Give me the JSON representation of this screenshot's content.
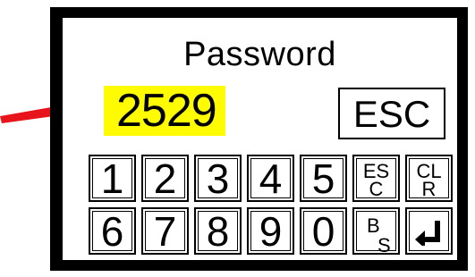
{
  "dialog": {
    "title": "Password",
    "password_value": "2529",
    "esc_button_label": "ESC"
  },
  "keypad": {
    "row1": [
      "1",
      "2",
      "3",
      "4",
      "5"
    ],
    "row2": [
      "6",
      "7",
      "8",
      "9",
      "0"
    ],
    "esc_key": {
      "line1": "ES",
      "line2": "C"
    },
    "clr_key": {
      "line1": "CL",
      "line2": "R"
    },
    "bs_key": {
      "line1": "B",
      "line2": "S"
    },
    "enter_icon": "enter-return-icon"
  },
  "annotation": {
    "arrow_icon": "red-arrow-icon",
    "arrow_color": "#e8141c",
    "highlight_color": "#fffb00"
  }
}
